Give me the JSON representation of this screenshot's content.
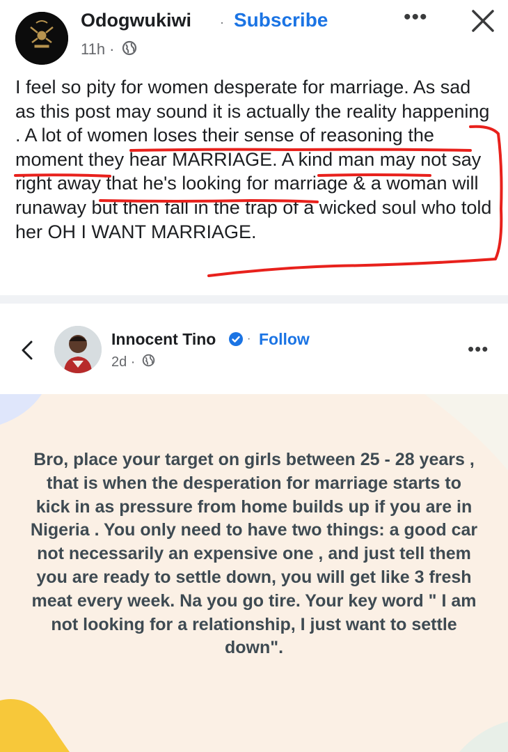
{
  "post1": {
    "author": "Odogwukiwi",
    "separator": "·",
    "subscribe_label": "Subscribe",
    "more_label": "•••",
    "time": "11h ·",
    "text": "I feel so pity for women desperate for marriage. As sad as this post may sound it is actually the reality happening . A lot of women loses their sense of reasoning the moment they hear MARRIAGE. A kind man may not say right away that he's looking for marriage & a woman will runaway but then fall in the trap of a wicked soul who told her OH I WANT MARRIAGE.",
    "annotation_color": "#e8211c"
  },
  "post2": {
    "author": "Innocent Tino",
    "separator": "·",
    "follow_label": "Follow",
    "more_label": "•••",
    "time": "2d ·",
    "card_text": "Bro, place your target on girls between 25 - 28 years , that is when the desperation for marriage starts to kick in as pressure from home builds up if you are in Nigeria . You only need to have two things: a good car not necessarily an expensive one , and just tell them you are ready to settle down, you will get like 3 fresh meat every week. Na you go tire. Your key word \" I am not looking for a relationship, I just want to settle down\".",
    "card_background": "#fbf0e5"
  },
  "icons": {
    "globe": "globe-icon",
    "close": "close-icon",
    "back": "chevron-left-icon",
    "verified": "verified-badge-icon"
  },
  "colors": {
    "link_blue": "#1b74e4",
    "text_primary": "#1c1e21",
    "text_secondary": "#65676b"
  }
}
